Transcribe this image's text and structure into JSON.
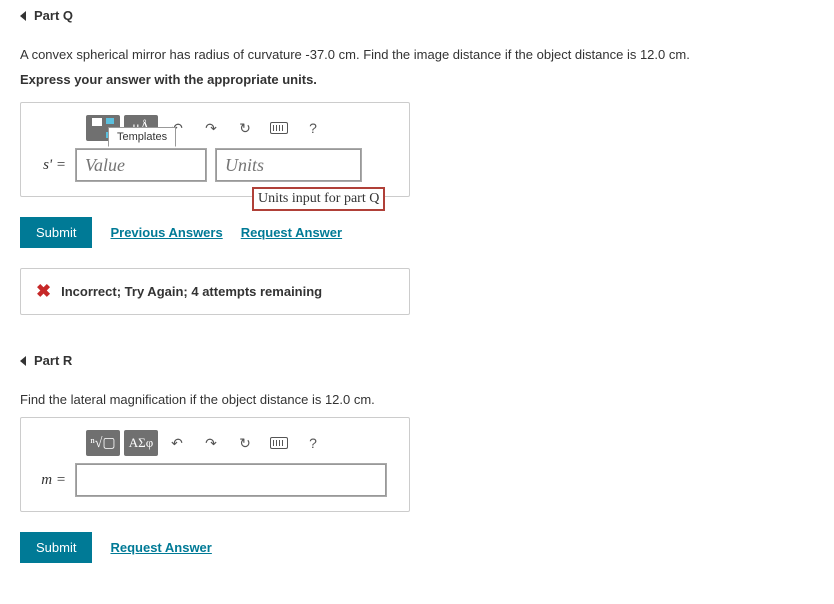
{
  "partQ": {
    "title": "Part Q",
    "question": "A convex spherical mirror has radius of curvature -37.0 cm. Find the image distance if the object distance is 12.0 cm.",
    "instruction": "Express your answer with the appropriate units.",
    "toolbar": {
      "units_symbols": "μÅ",
      "help": "?"
    },
    "templates_label": "Templates",
    "var_label": "s' =",
    "value_placeholder": "Value",
    "units_placeholder": "Units",
    "tooltip": "Units input for part Q",
    "submit": "Submit",
    "previous_answers": "Previous Answers",
    "request_answer": "Request Answer",
    "feedback": "Incorrect; Try Again; 4 attempts remaining"
  },
  "partR": {
    "title": "Part R",
    "question": "Find the lateral magnification if the object distance is 12.0 cm.",
    "toolbar": {
      "greek": "ΑΣφ",
      "help": "?"
    },
    "var_label": "m =",
    "submit": "Submit",
    "request_answer": "Request Answer"
  }
}
